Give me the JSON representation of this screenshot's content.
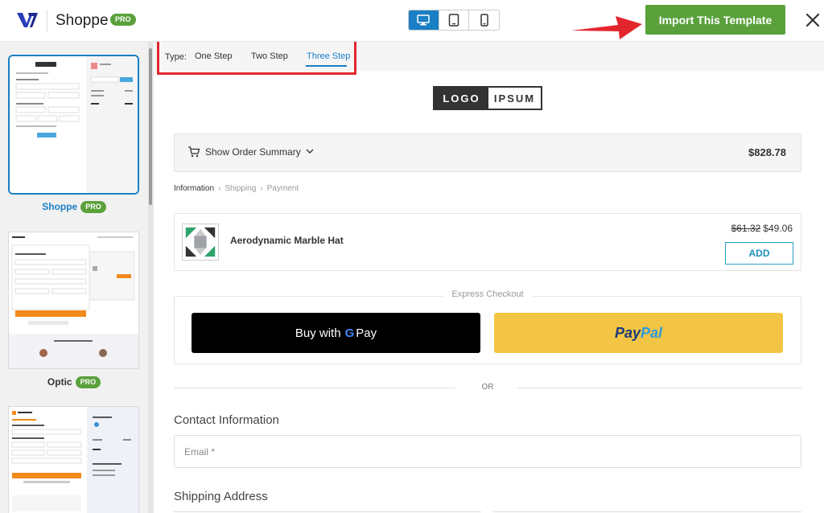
{
  "header": {
    "app_title": "Shoppe",
    "pro_badge": "PRO",
    "import_label": "Import This Template",
    "device_buttons": [
      "desktop-icon",
      "tablet-icon",
      "mobile-icon"
    ],
    "active_device": "desktop"
  },
  "sidebar": {
    "templates": [
      {
        "name": "Shoppe",
        "badge": "PRO",
        "selected": true
      },
      {
        "name": "Optic",
        "badge": "PRO",
        "selected": false
      },
      {
        "name": "",
        "badge": "",
        "selected": false
      }
    ]
  },
  "type_bar": {
    "label": "Type:",
    "tabs": [
      "One Step",
      "Two Step",
      "Three Step"
    ],
    "active_tab": "Three Step"
  },
  "preview": {
    "logo_left": "LOGO",
    "logo_right": "IPSUM",
    "order_summary_label": "Show Order Summary",
    "order_total": "$828.78",
    "breadcrumbs": [
      "Information",
      "Shipping",
      "Payment"
    ],
    "product": {
      "name": "Aerodynamic Marble Hat",
      "old_price": "$61.32",
      "price": "$49.06",
      "add_label": "ADD"
    },
    "express_label": "Express Checkout",
    "gpay_prefix": "Buy with",
    "gpay_g": "G",
    "gpay_pay": "Pay",
    "paypal_a": "Pay",
    "paypal_b": "Pal",
    "or_label": "OR",
    "contact_title": "Contact Information",
    "email_placeholder": "Email *",
    "shipping_title": "Shipping Address"
  },
  "colors": {
    "accent_blue": "#1a7fc4",
    "pro_green": "#5aa13c",
    "import_green": "#5aa13c",
    "highlight_red": "#e3262e",
    "paypal_yellow": "#f3c544"
  }
}
